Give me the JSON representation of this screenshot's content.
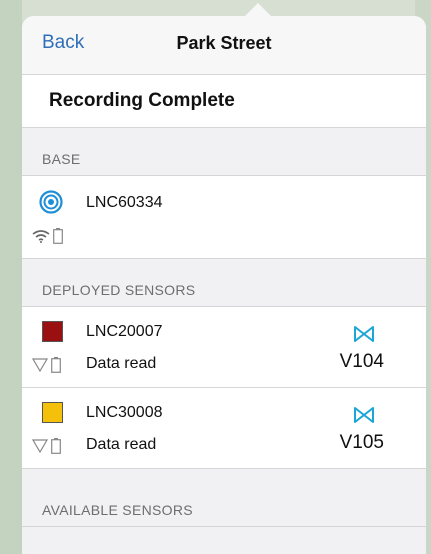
{
  "nav": {
    "back_label": "Back",
    "title": "Park Street"
  },
  "status": {
    "text": "Recording Complete"
  },
  "sections": {
    "base": "BASE",
    "deployed": "DEPLOYED SENSORS",
    "available": "AVAILABLE SENSORS"
  },
  "base": {
    "name": "LNC60334",
    "icon": "target-icon",
    "accent": "#1d8fd6"
  },
  "deployed": [
    {
      "name": "LNC20007",
      "status": "Data read",
      "code": "V104",
      "color": "#9a0f0f",
      "icon": "bowtie-icon"
    },
    {
      "name": "LNC30008",
      "status": "Data read",
      "code": "V105",
      "color": "#f5c00a",
      "icon": "bowtie-icon"
    }
  ],
  "colors": {
    "link": "#2f6fb8",
    "bowtie": "#1ca6d6"
  }
}
